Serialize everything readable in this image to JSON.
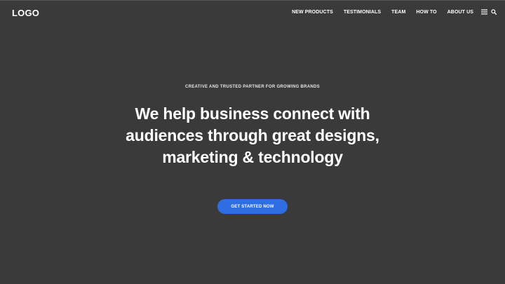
{
  "header": {
    "logo": "LOGO",
    "nav": [
      {
        "label": "NEW PRODUCTS"
      },
      {
        "label": "TESTIMONIALS"
      },
      {
        "label": "TEAM"
      },
      {
        "label": "HOW TO"
      },
      {
        "label": "ABOUT US"
      }
    ],
    "icons": [
      "menu-icon",
      "search-icon"
    ]
  },
  "hero": {
    "tagline": "CREATIVE AND TRUSTED PARTNER FOR GROWING BRANDS",
    "headline": "We help business connect with audiences through great designs, marketing & technology",
    "cta_label": "GET STARTED NOW"
  },
  "colors": {
    "background": "#3a3a3a",
    "accent": "#2f6de3",
    "text": "#ffffff"
  }
}
